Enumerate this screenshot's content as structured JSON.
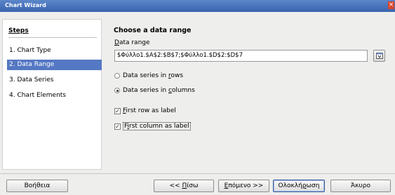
{
  "window": {
    "title": "Chart Wizard"
  },
  "steps": {
    "title": "Steps",
    "items": [
      {
        "label": "1. Chart Type"
      },
      {
        "label": "2. Data Range"
      },
      {
        "label": "3. Data Series"
      },
      {
        "label": "4. Chart Elements"
      }
    ],
    "active_index": 1
  },
  "content": {
    "heading": "Choose a data range",
    "data_range_label": "Data range",
    "data_range_value": "$Φύλλο1.$A$2:$B$7;$Φύλλο1.$D$2:$D$7",
    "series_in_rows": "Data series in rows",
    "series_in_columns": "Data series in columns",
    "selected_series_orientation": "columns",
    "first_row_label": "First row as label",
    "first_row_checked": true,
    "first_column_label": "First column as label",
    "first_column_checked": true
  },
  "buttons": {
    "help": "Βοήθεια",
    "back": "<< Πίσω",
    "next": "Επόμενο >>",
    "finish": "Ολοκλήρωση",
    "cancel": "Άκυρο"
  },
  "colors": {
    "titlebar": "#3a64ad",
    "selection": "#5478c3"
  },
  "icons": {
    "close": "close-icon",
    "range_select": "select-range-icon"
  }
}
